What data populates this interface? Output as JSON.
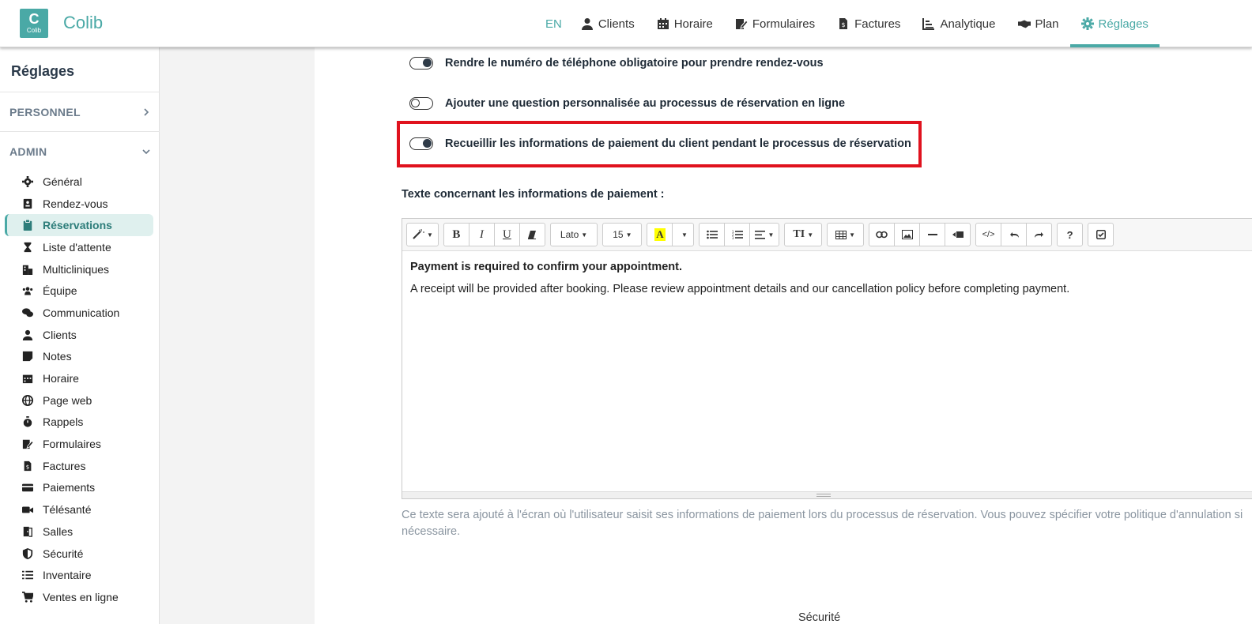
{
  "app": {
    "brand": "Colib",
    "logo_letter": "C",
    "logo_text": "Colib"
  },
  "nav": {
    "lang": "EN",
    "items": [
      {
        "label": "Clients",
        "icon": "user-icon"
      },
      {
        "label": "Horaire",
        "icon": "calendar-icon"
      },
      {
        "label": "Formulaires",
        "icon": "form-edit-icon"
      },
      {
        "label": "Factures",
        "icon": "invoice-icon"
      },
      {
        "label": "Analytique",
        "icon": "chart-icon"
      },
      {
        "label": "Plan",
        "icon": "handshake-icon"
      },
      {
        "label": "Réglages",
        "icon": "gear-icon",
        "active": true
      }
    ],
    "accent": "#4aa9a6"
  },
  "sidebar": {
    "title": "Réglages",
    "personnel": "PERSONNEL",
    "admin": "ADMIN",
    "items": [
      {
        "label": "Général",
        "icon": "gear-icon"
      },
      {
        "label": "Rendez-vous",
        "icon": "appointment-icon"
      },
      {
        "label": "Réservations",
        "icon": "clipboard-icon",
        "active": true
      },
      {
        "label": "Liste d'attente",
        "icon": "hourglass-icon"
      },
      {
        "label": "Multicliniques",
        "icon": "building-icon"
      },
      {
        "label": "Équipe",
        "icon": "team-icon"
      },
      {
        "label": "Communication",
        "icon": "chat-icon"
      },
      {
        "label": "Clients",
        "icon": "user-icon"
      },
      {
        "label": "Notes",
        "icon": "note-icon"
      },
      {
        "label": "Horaire",
        "icon": "calendar-icon"
      },
      {
        "label": "Page web",
        "icon": "globe-icon"
      },
      {
        "label": "Rappels",
        "icon": "stopwatch-icon"
      },
      {
        "label": "Formulaires",
        "icon": "form-edit-icon"
      },
      {
        "label": "Factures",
        "icon": "invoice-icon"
      },
      {
        "label": "Paiements",
        "icon": "credit-card-icon"
      },
      {
        "label": "Télésanté",
        "icon": "video-icon"
      },
      {
        "label": "Salles",
        "icon": "door-icon"
      },
      {
        "label": "Sécurité",
        "icon": "shield-icon"
      },
      {
        "label": "Inventaire",
        "icon": "list-icon"
      },
      {
        "label": "Ventes en ligne",
        "icon": "cart-icon"
      }
    ]
  },
  "settings": {
    "toggle_phone": {
      "label": "Rendre le numéro de téléphone obligatoire pour prendre rendez-vous",
      "on": true
    },
    "toggle_question": {
      "label": "Ajouter une question personnalisée au processus de réservation en ligne",
      "on": false
    },
    "toggle_payment": {
      "label": "Recueillir les informations de paiement du client pendant le processus de réservation",
      "on": true
    },
    "payment_text_label": "Texte concernant les informations de paiement :",
    "help_line1": "Ce texte sera ajouté à l'écran où l'utilisateur saisit ses informations de paiement lors du processus de réservation. Vous pouvez spécifier votre politique d'annulation si",
    "help_line2": "nécessaire.",
    "next_section_partial": "Sécurité"
  },
  "editor": {
    "font_name": "Lato",
    "font_size": "15",
    "content_line1": "Payment is required to confirm your appointment.",
    "content_line2": "A receipt will be provided after booking. Please review appointment details and our cancellation policy before completing payment."
  }
}
